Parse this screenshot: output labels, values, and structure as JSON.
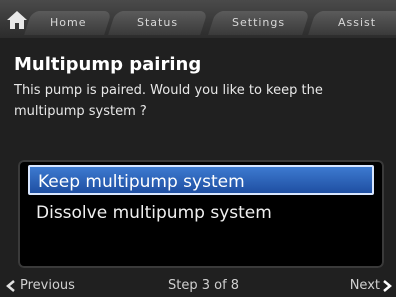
{
  "tabs": [
    {
      "label": "Home"
    },
    {
      "label": "Status"
    },
    {
      "label": "Settings"
    },
    {
      "label": "Assist"
    }
  ],
  "header": {
    "title": "Multipump pairing",
    "description": "This pump is paired. Would you like to keep the multipump system ?"
  },
  "options": {
    "selected_index": 0,
    "items": [
      {
        "label": "Keep multipump system"
      },
      {
        "label": "Dissolve multipump system"
      }
    ]
  },
  "footer": {
    "previous_label": "Previous",
    "step_label": "Step 3 of 8",
    "next_label": "Next"
  },
  "icons": {
    "home": "house-icon",
    "previous": "chevron-left-icon",
    "next": "chevron-right-icon"
  },
  "colors": {
    "selection": "#2f66c1",
    "background": "#202020"
  }
}
